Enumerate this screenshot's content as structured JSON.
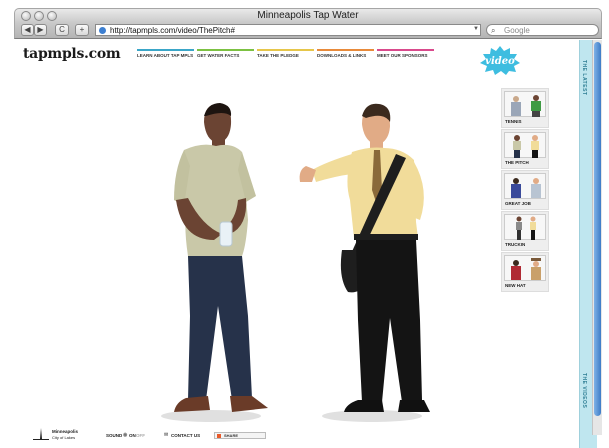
{
  "window": {
    "title": "Minneapolis Tap Water"
  },
  "toolbar": {
    "back_label": "◀",
    "forward_label": "▶",
    "reload_label": "C",
    "add_label": "+",
    "url": "http://tapmpls.com/video/ThePitch#",
    "search_placeholder": "Google"
  },
  "site": {
    "logo": "tapmpls.com",
    "nav": [
      {
        "label": "LEARN ABOUT TAP MPLS",
        "color": "#3aa6c8"
      },
      {
        "label": "GET WATER FACTS",
        "color": "#7cc142"
      },
      {
        "label": "TAKE THE PLEDGE",
        "color": "#e6c64a"
      },
      {
        "label": "DOWNLOADS & LINKS",
        "color": "#e88a3a"
      },
      {
        "label": "MEET OUR SPONSORS",
        "color": "#d94a8c"
      }
    ],
    "badge": "video"
  },
  "rail": {
    "top_label": "THE LATEST",
    "bottom_label": "THE VIDEOS",
    "videos": [
      {
        "label": "TENNIS"
      },
      {
        "label": "THE PITCH"
      },
      {
        "label": "GREAT JOB"
      },
      {
        "label": "TRUCKIN"
      },
      {
        "label": "NEW HAT"
      }
    ]
  },
  "footer": {
    "city_name": "Minneapolis",
    "city_sub": "City of Lakes",
    "sound_label": "SOUND",
    "sound_on": "ON",
    "sound_off": "OFF",
    "contact": "CONTACT US",
    "share": "SHARE"
  },
  "colors": {
    "accent": "#3e7cc7",
    "rail": "#bfe6ef",
    "shirt_left": "#c9c8a8",
    "shirt_right": "#f1dc9a"
  }
}
